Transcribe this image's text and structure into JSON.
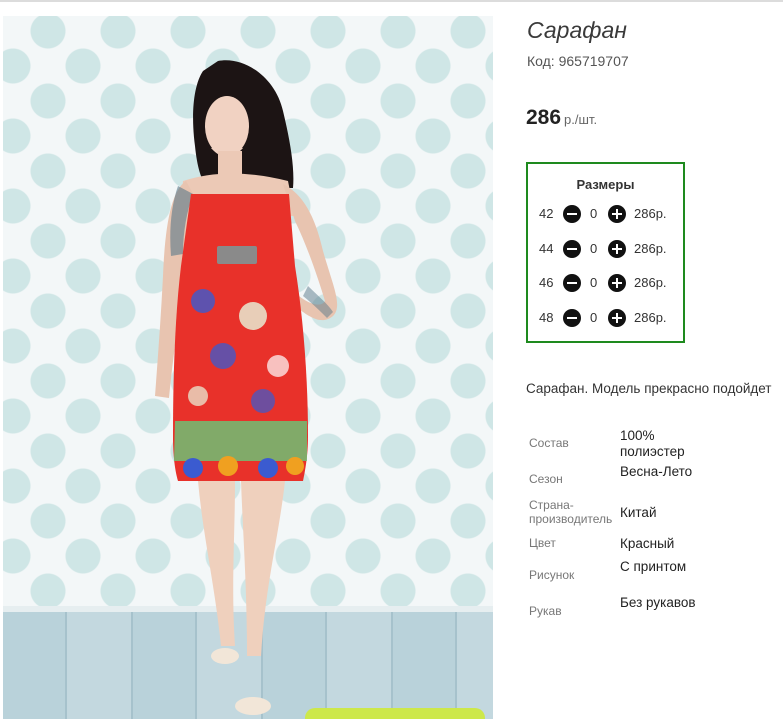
{
  "product": {
    "title": "Сарафан",
    "code": "Код: 965719707",
    "price": "286",
    "price_unit": "р./шт.",
    "description": "Сарафан. Модель прекрасно подойдет"
  },
  "sizes": {
    "title": "Размеры",
    "rows": [
      {
        "size": "42",
        "qty": "0",
        "price": "286р."
      },
      {
        "size": "44",
        "qty": "0",
        "price": "286р."
      },
      {
        "size": "46",
        "qty": "0",
        "price": "286р."
      },
      {
        "size": "48",
        "qty": "0",
        "price": "286р."
      }
    ]
  },
  "attributes": [
    {
      "label": "Состав",
      "value": "100% полиэстер"
    },
    {
      "label": "Сезон",
      "value": "Весна-Лето"
    },
    {
      "label": "Страна-производитель",
      "value": "Китай"
    },
    {
      "label": "Цвет",
      "value": "Красный"
    },
    {
      "label": "Рисунок",
      "value": "С принтом"
    },
    {
      "label": "Рукав",
      "value": "Без рукавов"
    }
  ],
  "colors": {
    "sizes_border": "#1e8a1e",
    "dress_red": "#e8312a",
    "wall_dots": "#cfe6e6"
  },
  "icons": [
    "minus-circle-icon",
    "plus-circle-icon"
  ]
}
